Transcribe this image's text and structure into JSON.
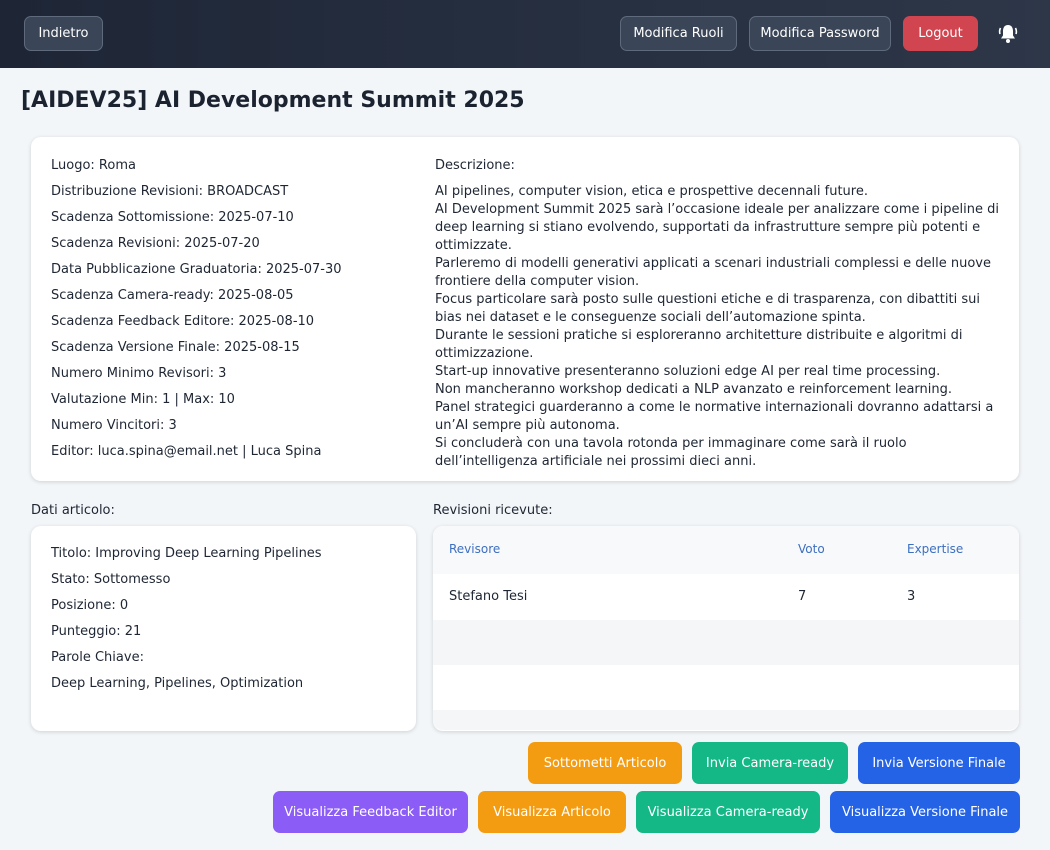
{
  "header": {
    "back_label": "Indietro",
    "edit_roles_label": "Modifica Ruoli",
    "edit_password_label": "Modifica Password",
    "logout_label": "Logout"
  },
  "conference": {
    "title": "[AIDEV25] AI Development Summit 2025",
    "info": [
      "Luogo: Roma",
      "Distribuzione Revisioni: BROADCAST",
      "Scadenza Sottomissione: 2025-07-10",
      "Scadenza Revisioni: 2025-07-20",
      "Data Pubblicazione Graduatoria: 2025-07-30",
      "Scadenza Camera-ready: 2025-08-05",
      "Scadenza Feedback Editore: 2025-08-10",
      "Scadenza Versione Finale: 2025-08-15",
      "Numero Minimo Revisori: 3",
      "Valutazione Min: 1 | Max: 10",
      "Numero Vincitori: 3",
      "Editor: luca.spina@email.net | Luca Spina"
    ],
    "description_label": "Descrizione:",
    "description": [
      "AI pipelines, computer vision, etica e prospettive decennali future.",
      "AI Development Summit 2025 sarà l’occasione ideale per analizzare come i pipeline di deep learning si stiano evolvendo, supportati da infrastrutture sempre più potenti e ottimizzate.",
      "Parleremo di modelli generativi applicati a scenari industriali complessi e delle nuove frontiere della computer vision.",
      "Focus particolare sarà posto sulle questioni etiche e di trasparenza, con dibattiti sui bias nei dataset e le conseguenze sociali dell’automazione spinta.",
      "Durante le sessioni pratiche si esploreranno architetture distribuite e algoritmi di ottimizzazione.",
      "Start-up innovative presenteranno soluzioni edge AI per real time processing.",
      "Non mancheranno workshop dedicati a NLP avanzato e reinforcement learning.",
      "Panel strategici guarderanno a come le normative internazionali dovranno adattarsi a un’AI sempre più autonoma.",
      "Si concluderà con una tavola rotonda per immaginare come sarà il ruolo dell’intelligenza artificiale nei prossimi dieci anni."
    ]
  },
  "article": {
    "section_label": "Dati articolo:",
    "lines": [
      "Titolo: Improving Deep Learning Pipelines",
      "Stato: Sottomesso",
      "Posizione: 0",
      "Punteggio: 21",
      "Parole Chiave:",
      "Deep Learning, Pipelines, Optimization"
    ]
  },
  "reviews": {
    "section_label": "Revisioni ricevute:",
    "columns": [
      "Revisore",
      "Voto",
      "Expertise"
    ],
    "rows": [
      {
        "reviewer": "Stefano Tesi",
        "score": "7",
        "expertise": "3"
      }
    ]
  },
  "actions": {
    "submit_article": "Sottometti Articolo",
    "send_camera_ready": "Invia Camera-ready",
    "send_final_version": "Invia Versione Finale",
    "view_editor_feedback": "Visualizza Feedback Editor",
    "view_article": "Visualizza Articolo",
    "view_camera_ready": "Visualizza Camera-ready",
    "view_final_version": "Visualizza Versione Finale"
  },
  "colors": {
    "logout": "#d04550",
    "orange": "#f39c12",
    "green": "#13b886",
    "blue": "#2563e6",
    "purple": "#8b5cf6"
  },
  "icons": [
    "bell-icon"
  ]
}
